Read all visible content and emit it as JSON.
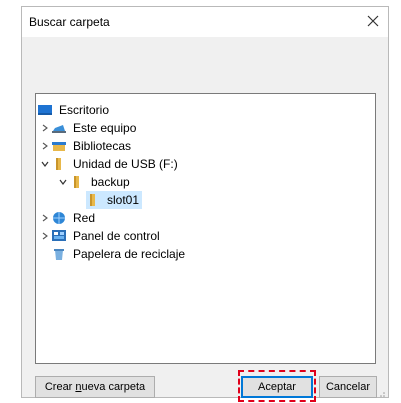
{
  "dialog": {
    "title": "Buscar carpeta",
    "close_icon": "close-icon"
  },
  "tree": {
    "items": [
      {
        "label": "Escritorio",
        "icon": "desktop-icon",
        "chevron": "none",
        "level": 0
      },
      {
        "label": "Este equipo",
        "icon": "computer-icon",
        "chevron": "right",
        "level": 1
      },
      {
        "label": "Bibliotecas",
        "icon": "libraries-icon",
        "chevron": "right",
        "level": 1
      },
      {
        "label": "Unidad de USB (F:)",
        "icon": "usb-drive-icon",
        "chevron": "down",
        "level": 1
      },
      {
        "label": "backup",
        "icon": "folder-icon",
        "chevron": "down",
        "level": 2
      },
      {
        "label": "slot01",
        "icon": "folder-icon",
        "chevron": "none",
        "level": 3,
        "selected": true
      },
      {
        "label": "Red",
        "icon": "network-icon",
        "chevron": "right",
        "level": 1
      },
      {
        "label": "Panel de control",
        "icon": "control-panel-icon",
        "chevron": "right",
        "level": 1
      },
      {
        "label": "Papelera de reciclaje",
        "icon": "recycle-bin-icon",
        "chevron": "none",
        "level": 1
      }
    ]
  },
  "buttons": {
    "new_folder_pre": "Crear ",
    "new_folder_ul": "n",
    "new_folder_post": "ueva carpeta",
    "ok": "Aceptar",
    "cancel": "Cancelar"
  },
  "colors": {
    "selection": "#cce8ff",
    "focus_outline": "#e0001a",
    "folder": "#e8b84a",
    "accent": "#0078d7"
  }
}
